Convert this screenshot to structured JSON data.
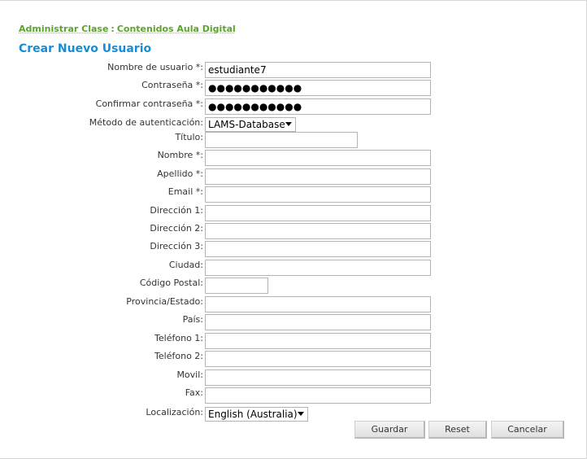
{
  "breadcrumb": {
    "item1": "Administrar Clase",
    "separator": ":",
    "item2": "Contenidos Aula Digital"
  },
  "page_title": "Crear Nuevo Usuario",
  "form": {
    "username": {
      "label": "Nombre de usuario *:",
      "value": "estudiante7"
    },
    "password": {
      "label": "Contraseña *:",
      "value": "●●●●●●●●●●●"
    },
    "password_confirm": {
      "label": "Confirmar contraseña *:",
      "value": "●●●●●●●●●●●"
    },
    "auth_method": {
      "label": "Método de autenticación:",
      "value": "LAMS-Database"
    },
    "title": {
      "label": "Título:",
      "value": ""
    },
    "first_name": {
      "label": "Nombre *:",
      "value": ""
    },
    "last_name": {
      "label": "Apellido *:",
      "value": ""
    },
    "email": {
      "label": "Email *:",
      "value": ""
    },
    "address1": {
      "label": "Dirección 1:",
      "value": ""
    },
    "address2": {
      "label": "Dirección 2:",
      "value": ""
    },
    "address3": {
      "label": "Dirección 3:",
      "value": ""
    },
    "city": {
      "label": "Ciudad:",
      "value": ""
    },
    "postal_code": {
      "label": "Código Postal:",
      "value": ""
    },
    "province": {
      "label": "Provincia/Estado:",
      "value": ""
    },
    "country": {
      "label": "País:",
      "value": ""
    },
    "phone1": {
      "label": "Teléfono 1:",
      "value": ""
    },
    "phone2": {
      "label": "Teléfono 2:",
      "value": ""
    },
    "mobile": {
      "label": "Movil:",
      "value": ""
    },
    "fax": {
      "label": "Fax:",
      "value": ""
    },
    "locale": {
      "label": "Localización:",
      "value": "English (Australia)"
    }
  },
  "buttons": {
    "save": "Guardar",
    "reset": "Reset",
    "cancel": "Cancelar"
  }
}
